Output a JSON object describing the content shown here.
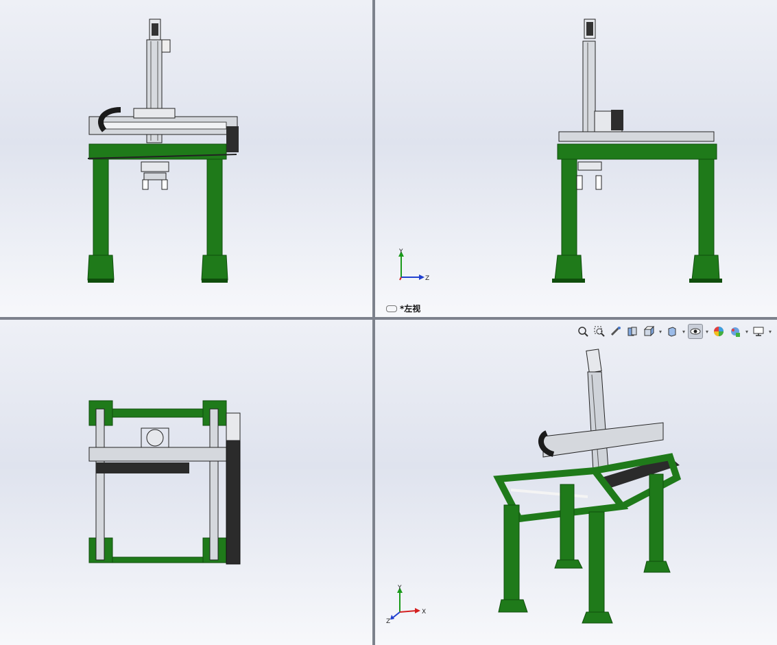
{
  "views": {
    "front": {
      "label": ""
    },
    "left": {
      "label": "*左视"
    },
    "top": {
      "label": ""
    },
    "iso": {
      "label": ""
    }
  },
  "triad_axes": {
    "left_view": {
      "up": "Y",
      "right": "Z"
    },
    "iso_view": {
      "up": "Y",
      "right": "X",
      "left": "Z"
    }
  },
  "toolbar": {
    "icons": [
      "zoom-to-fit-icon",
      "zoom-area-icon",
      "previous-view-icon",
      "section-view-icon",
      "view-orientation-icon",
      "display-style-icon",
      "hide-show-items-icon",
      "edit-appearance-icon",
      "apply-scene-icon",
      "view-settings-icon"
    ]
  },
  "colors": {
    "frame_green": "#1f7a1a",
    "frame_dark": "#0f4d0c",
    "rail_gray": "#c8ccd2",
    "belt_dark": "#2b2b2b",
    "axis_y": "#1a9a1a",
    "axis_x": "#d42020",
    "axis_z": "#2040d0"
  }
}
